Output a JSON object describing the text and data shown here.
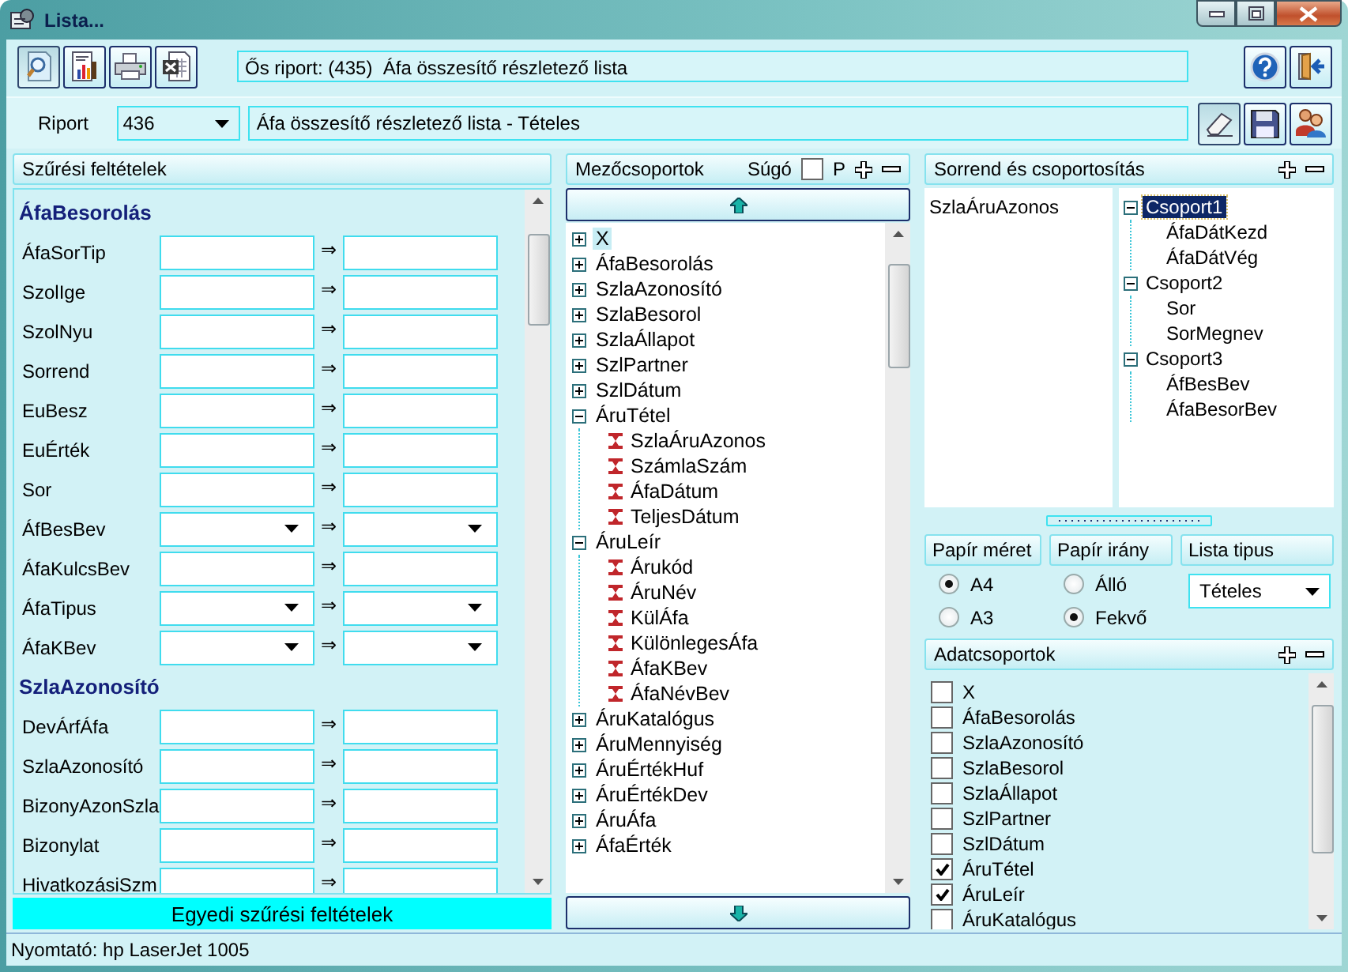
{
  "window": {
    "title": "Lista..."
  },
  "parent_report": "Ős riport: (435)  Áfa összesítő részletező lista",
  "report": {
    "label": "Riport",
    "number": "436",
    "name": "Áfa összesítő részletező lista - Tételes"
  },
  "filter_panel": {
    "title": "Szűrési feltételek",
    "groups": [
      {
        "title": "ÁfaBesorolás",
        "fields": [
          {
            "label": "ÁfaSorTip",
            "kind": "text",
            "separator": "⇒"
          },
          {
            "label": "SzolIge",
            "kind": "text",
            "separator": "⇒"
          },
          {
            "label": "SzolNyu",
            "kind": "text",
            "separator": "⇒"
          },
          {
            "label": "Sorrend",
            "kind": "text",
            "separator": "⇒"
          },
          {
            "label": "EuBesz",
            "kind": "text",
            "separator": "⇒"
          },
          {
            "label": "EuÉrték",
            "kind": "text",
            "separator": "⇒"
          },
          {
            "label": "Sor",
            "kind": "text",
            "separator": "⇒"
          },
          {
            "label": "ÁfBesBev",
            "kind": "dropdown",
            "separator": "⇒"
          },
          {
            "label": "ÁfaKulcsBev",
            "kind": "text",
            "separator": "⇒"
          },
          {
            "label": "ÁfaTipus",
            "kind": "dropdown",
            "separator": "⇒"
          },
          {
            "label": "ÁfaKBev",
            "kind": "dropdown",
            "separator": "⇒"
          }
        ]
      },
      {
        "title": "SzlaAzonosító",
        "fields": [
          {
            "label": "DevÁrfÁfa",
            "kind": "text",
            "separator": "⇒"
          },
          {
            "label": "SzlaAzonosító",
            "kind": "text",
            "separator": "⇒"
          },
          {
            "label": "BizonyAzonSzla",
            "kind": "text",
            "separator": "⇒"
          },
          {
            "label": "Bizonylat",
            "kind": "text",
            "separator": "⇒"
          },
          {
            "label": "HivatkozásiSzm",
            "kind": "text",
            "separator": "⇒"
          }
        ]
      }
    ],
    "custom_button": "Egyedi szűrési feltételek"
  },
  "field_groups": {
    "title": "Mezőcsoportok",
    "help_label": "Súgó",
    "help_checked": false,
    "p_label": "P",
    "tree": [
      {
        "label": "X",
        "kind": "group",
        "expanded": false,
        "selected": true
      },
      {
        "label": "ÁfaBesorolás",
        "kind": "group",
        "expanded": false,
        "selected": false
      },
      {
        "label": "SzlaAzonosító",
        "kind": "group",
        "expanded": false,
        "selected": false
      },
      {
        "label": "SzlaBesorol",
        "kind": "group",
        "expanded": false,
        "selected": false
      },
      {
        "label": "SzlaÁllapot",
        "kind": "group",
        "expanded": false,
        "selected": false
      },
      {
        "label": "SzlPartner",
        "kind": "group",
        "expanded": false,
        "selected": false
      },
      {
        "label": "SzlDátum",
        "kind": "group",
        "expanded": false,
        "selected": false
      },
      {
        "label": "ÁruTétel",
        "kind": "group",
        "expanded": true,
        "selected": false,
        "children": [
          {
            "label": "SzlaÁruAzonos",
            "kind": "field",
            "selected": false
          },
          {
            "label": "SzámlaSzám",
            "kind": "field",
            "selected": false
          },
          {
            "label": "ÁfaDátum",
            "kind": "field",
            "selected": false
          },
          {
            "label": "TeljesDátum",
            "kind": "field",
            "selected": false
          }
        ]
      },
      {
        "label": "ÁruLeír",
        "kind": "group",
        "expanded": true,
        "selected": false,
        "children": [
          {
            "label": "Árukód",
            "kind": "field",
            "selected": false
          },
          {
            "label": "ÁruNév",
            "kind": "field",
            "selected": false
          },
          {
            "label": "KülÁfa",
            "kind": "field",
            "selected": false
          },
          {
            "label": "KülönlegesÁfa",
            "kind": "field",
            "selected": false
          },
          {
            "label": "ÁfaKBev",
            "kind": "field",
            "selected": false
          },
          {
            "label": "ÁfaNévBev",
            "kind": "field",
            "selected": false
          }
        ]
      },
      {
        "label": "ÁruKatalógus",
        "kind": "group",
        "expanded": false,
        "selected": false
      },
      {
        "label": "ÁruMennyiség",
        "kind": "group",
        "expanded": false,
        "selected": false
      },
      {
        "label": "ÁruÉrtékHuf",
        "kind": "group",
        "expanded": false,
        "selected": false
      },
      {
        "label": "ÁruÉrtékDev",
        "kind": "group",
        "expanded": false,
        "selected": false
      },
      {
        "label": "ÁruÁfa",
        "kind": "group",
        "expanded": false,
        "selected": false
      },
      {
        "label": "ÁfaÉrték",
        "kind": "group",
        "expanded": false,
        "selected": false
      }
    ]
  },
  "sort_grouping": {
    "title": "Sorrend és csoportosítás",
    "sort_fields": [
      "SzlaÁruAzonos"
    ],
    "groups": [
      {
        "label": "Csoport1",
        "expanded": true,
        "selected": true,
        "children": [
          "ÁfaDátKezd",
          "ÁfaDátVég"
        ]
      },
      {
        "label": "Csoport2",
        "expanded": true,
        "selected": false,
        "children": [
          "Sor",
          "SorMegnev"
        ]
      },
      {
        "label": "Csoport3",
        "expanded": true,
        "selected": false,
        "children": [
          "ÁfBesBev",
          "ÁfaBesorBev"
        ]
      }
    ]
  },
  "paper_size": {
    "label": "Papír méret",
    "options": [
      {
        "label": "A4",
        "selected": true
      },
      {
        "label": "A3",
        "selected": false
      }
    ]
  },
  "paper_orientation": {
    "label": "Papír irány",
    "options": [
      {
        "label": "Álló",
        "selected": false
      },
      {
        "label": "Fekvő",
        "selected": true
      }
    ]
  },
  "list_type": {
    "label": "Lista tipus",
    "value": "Tételes"
  },
  "data_groups": {
    "title": "Adatcsoportok",
    "items": [
      {
        "label": "X",
        "checked": false
      },
      {
        "label": "ÁfaBesorolás",
        "checked": false
      },
      {
        "label": "SzlaAzonosító",
        "checked": false
      },
      {
        "label": "SzlaBesorol",
        "checked": false
      },
      {
        "label": "SzlaÁllapot",
        "checked": false
      },
      {
        "label": "SzlPartner",
        "checked": false
      },
      {
        "label": "SzlDátum",
        "checked": false
      },
      {
        "label": "ÁruTétel",
        "checked": true
      },
      {
        "label": "ÁruLeír",
        "checked": true
      },
      {
        "label": "ÁruKatalógus",
        "checked": false
      }
    ]
  },
  "status_bar": "Nyomtató: hp LaserJet 1005"
}
